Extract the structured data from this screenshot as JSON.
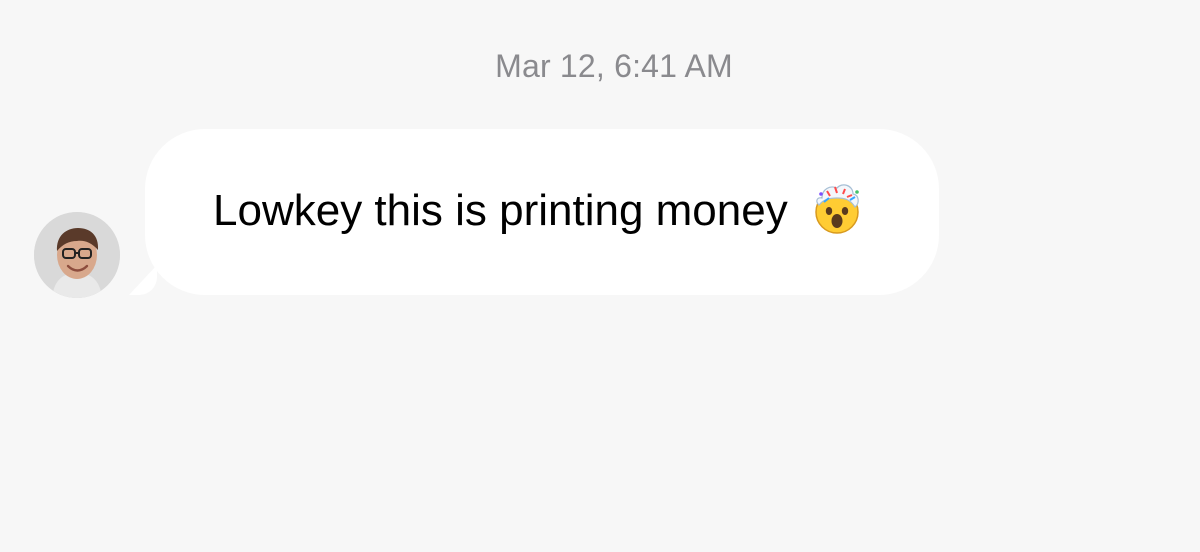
{
  "conversation": {
    "timestamp": "Mar 12, 6:41 AM",
    "messages": [
      {
        "direction": "incoming",
        "text": "Lowkey this is printing money",
        "emoji_icon": "exploding-head-emoji-icon",
        "avatar_icon": "contact-avatar-icon"
      }
    ]
  },
  "colors": {
    "background": "#f7f7f7",
    "bubble": "#ffffff",
    "timestamp": "#8a8a8e",
    "text": "#000000"
  }
}
